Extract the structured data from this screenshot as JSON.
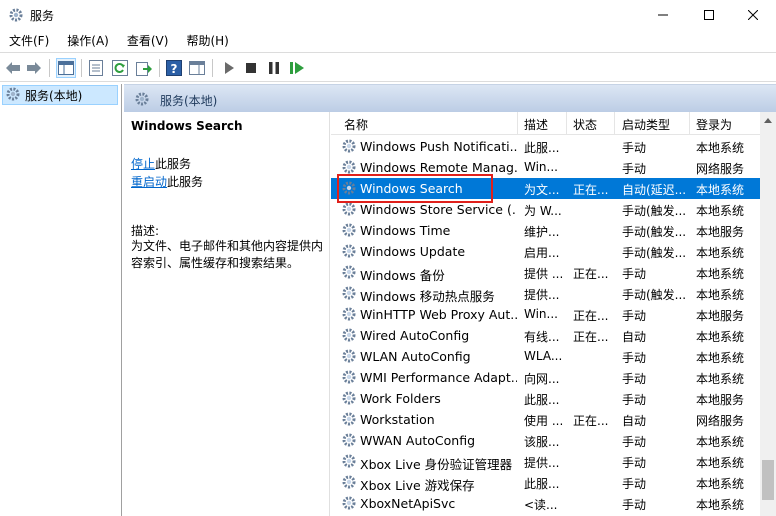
{
  "window": {
    "title": "服务"
  },
  "menu": [
    "文件(F)",
    "操作(A)",
    "查看(V)",
    "帮助(H)"
  ],
  "tree": {
    "root_label": "服务(本地)"
  },
  "header": {
    "title": "服务(本地)"
  },
  "details": {
    "service_name": "Windows Search",
    "stop_link": "停止",
    "stop_suffix": "此服务",
    "restart_link": "重启动",
    "restart_suffix": "此服务",
    "desc_label": "描述:",
    "desc_text": "为文件、电子邮件和其他内容提供内容索引、属性缓存和搜索结果。"
  },
  "columns": {
    "name": "名称",
    "desc": "描述",
    "status": "状态",
    "startup": "启动类型",
    "logon": "登录为"
  },
  "rows": [
    {
      "name": "Windows Push Notificati...",
      "desc": "此服...",
      "status": "",
      "startup": "手动",
      "logon": "本地系统"
    },
    {
      "name": "Windows Remote Manag...",
      "desc": "Win...",
      "status": "",
      "startup": "手动",
      "logon": "网络服务"
    },
    {
      "name": "Windows Search",
      "desc": "为文...",
      "status": "正在...",
      "startup": "自动(延迟...",
      "logon": "本地系统",
      "selected": true
    },
    {
      "name": "Windows Store Service (...",
      "desc": "为 W...",
      "status": "",
      "startup": "手动(触发...",
      "logon": "本地系统"
    },
    {
      "name": "Windows Time",
      "desc": "维护...",
      "status": "",
      "startup": "手动(触发...",
      "logon": "本地服务"
    },
    {
      "name": "Windows Update",
      "desc": "启用...",
      "status": "",
      "startup": "手动(触发...",
      "logon": "本地系统"
    },
    {
      "name": "Windows 备份",
      "desc": "提供 ...",
      "status": "正在...",
      "startup": "手动",
      "logon": "本地系统"
    },
    {
      "name": "Windows 移动热点服务",
      "desc": "提供...",
      "status": "",
      "startup": "手动(触发...",
      "logon": "本地系统"
    },
    {
      "name": "WinHTTP Web Proxy Aut...",
      "desc": "Win...",
      "status": "正在...",
      "startup": "手动",
      "logon": "本地服务"
    },
    {
      "name": "Wired AutoConfig",
      "desc": "有线...",
      "status": "正在...",
      "startup": "自动",
      "logon": "本地系统"
    },
    {
      "name": "WLAN AutoConfig",
      "desc": "WLA...",
      "status": "",
      "startup": "手动",
      "logon": "本地系统"
    },
    {
      "name": "WMI Performance Adapt...",
      "desc": "向网...",
      "status": "",
      "startup": "手动",
      "logon": "本地系统"
    },
    {
      "name": "Work Folders",
      "desc": "此服...",
      "status": "",
      "startup": "手动",
      "logon": "本地服务"
    },
    {
      "name": "Workstation",
      "desc": "使用 ...",
      "status": "正在...",
      "startup": "自动",
      "logon": "网络服务"
    },
    {
      "name": "WWAN AutoConfig",
      "desc": "该服...",
      "status": "",
      "startup": "手动",
      "logon": "本地系统"
    },
    {
      "name": "Xbox Live 身份验证管理器",
      "desc": "提供...",
      "status": "",
      "startup": "手动",
      "logon": "本地系统"
    },
    {
      "name": "Xbox Live 游戏保存",
      "desc": "此服...",
      "status": "",
      "startup": "手动",
      "logon": "本地系统"
    },
    {
      "name": "XboxNetApiSvc",
      "desc": "<读...",
      "status": "",
      "startup": "手动",
      "logon": "本地系统"
    }
  ],
  "colors": {
    "selection": "#0078d7",
    "highlight_box": "#e0201b",
    "link": "#0066cc"
  },
  "icons": {
    "window": "services-gear-icon",
    "service": "gear-icon",
    "toolbar": [
      "back-arrow-icon",
      "forward-arrow-icon",
      "show-tree-icon",
      "properties-icon",
      "refresh-icon",
      "export-icon",
      "help-icon",
      "show-hide-pane-icon",
      "start-icon",
      "stop-icon",
      "pause-icon",
      "restart-icon"
    ]
  }
}
